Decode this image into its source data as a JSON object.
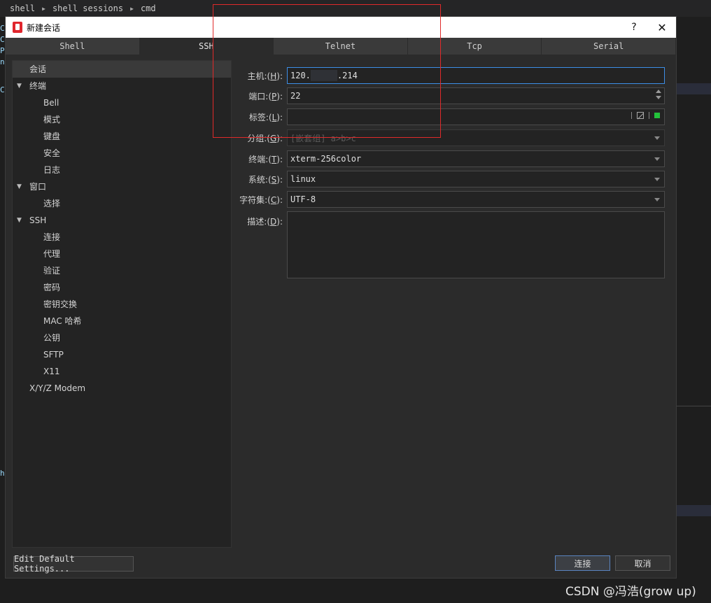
{
  "breadcrumb": [
    "shell",
    "shell sessions",
    "cmd"
  ],
  "background_left_text": [
    "C",
    "C",
    "P",
    "n",
    "C",
    "h"
  ],
  "dialog": {
    "title": "新建会话",
    "help": "?",
    "close": "✕"
  },
  "tabs": [
    {
      "label": "Shell",
      "active": false
    },
    {
      "label": "SSH",
      "active": true
    },
    {
      "label": "Telnet",
      "active": false
    },
    {
      "label": "Tcp",
      "active": false
    },
    {
      "label": "Serial",
      "active": false
    }
  ],
  "tree": [
    {
      "label": "会话",
      "level": 0,
      "selected": true,
      "expand": false
    },
    {
      "label": "终端",
      "level": 0,
      "expand": true
    },
    {
      "label": "Bell",
      "level": 1
    },
    {
      "label": "模式",
      "level": 1
    },
    {
      "label": "键盘",
      "level": 1
    },
    {
      "label": "安全",
      "level": 1
    },
    {
      "label": "日志",
      "level": 1
    },
    {
      "label": "窗口",
      "level": 0,
      "expand": true
    },
    {
      "label": "选择",
      "level": 1
    },
    {
      "label": "SSH",
      "level": 0,
      "expand": true
    },
    {
      "label": "连接",
      "level": 1
    },
    {
      "label": "代理",
      "level": 1
    },
    {
      "label": "验证",
      "level": 1
    },
    {
      "label": "密码",
      "level": 1
    },
    {
      "label": "密钥交换",
      "level": 1
    },
    {
      "label": "MAC 哈希",
      "level": 1
    },
    {
      "label": "公钥",
      "level": 1
    },
    {
      "label": "SFTP",
      "level": 1
    },
    {
      "label": "X11",
      "level": 1
    },
    {
      "label": "X/Y/Z Modem",
      "level": 0,
      "expand": false
    }
  ],
  "form": {
    "host": {
      "label": "主机:(",
      "key": "H",
      "suffix": "):",
      "value_start": "120.",
      "value_end": ".214"
    },
    "port": {
      "label": "端口:(",
      "key": "P",
      "suffix": "):",
      "value": "22"
    },
    "tag": {
      "label": "标签:(",
      "key": "L",
      "suffix": "):",
      "value": ""
    },
    "group": {
      "label": "分组:(",
      "key": "G",
      "suffix": "):",
      "placeholder": "[嵌套组] a>b>c"
    },
    "terminal": {
      "label": "终端:(",
      "key": "T",
      "suffix": "):",
      "value": "xterm-256color"
    },
    "system": {
      "label": "系统:(",
      "key": "S",
      "suffix": "):",
      "value": "linux"
    },
    "charset": {
      "label": "字符集:(",
      "key": "C",
      "suffix": "):",
      "value": "UTF-8"
    },
    "description": {
      "label": "描述:(",
      "key": "D",
      "suffix": "):",
      "value": ""
    }
  },
  "buttons": {
    "edit_default": "Edit Default Settings...",
    "connect": "连接",
    "cancel": "取消"
  },
  "colors": {
    "accent": "#3d8ee6",
    "annotation": "#e02a2a",
    "tag_color": "#23c23b"
  },
  "watermark": "CSDN @冯浩(grow up)"
}
